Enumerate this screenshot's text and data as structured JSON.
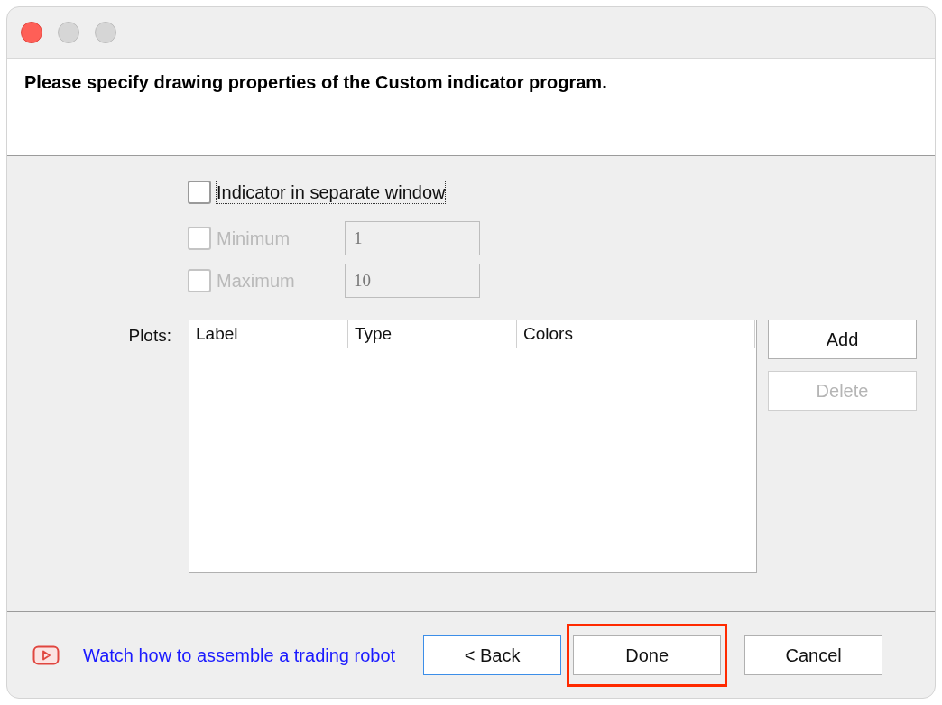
{
  "header": {
    "instruction": "Please specify drawing properties of the Custom indicator program."
  },
  "options": [
    {
      "kind": "checkbox",
      "label": "Indicator in separate window",
      "checked": false,
      "disabled": false,
      "focused": true
    },
    {
      "kind": "bound",
      "label": "Minimum",
      "checked": false,
      "disabled": true,
      "focused": false,
      "value": "1"
    },
    {
      "kind": "bound",
      "label": "Maximum",
      "checked": false,
      "disabled": true,
      "focused": false,
      "value": "10"
    }
  ],
  "plots": {
    "label": "Plots:",
    "columns": [
      "Label",
      "Type",
      "Colors"
    ],
    "buttons": [
      {
        "label": "Add",
        "disabled": false
      },
      {
        "label": "Delete",
        "disabled": true
      }
    ]
  },
  "footer": {
    "link": "Watch how to assemble a trading robot",
    "buttons": [
      {
        "label": "< Back",
        "focused": true,
        "highlighted": false
      },
      {
        "label": "Done",
        "focused": false,
        "highlighted": true
      },
      {
        "label": "Cancel",
        "focused": false,
        "highlighted": false
      }
    ]
  }
}
